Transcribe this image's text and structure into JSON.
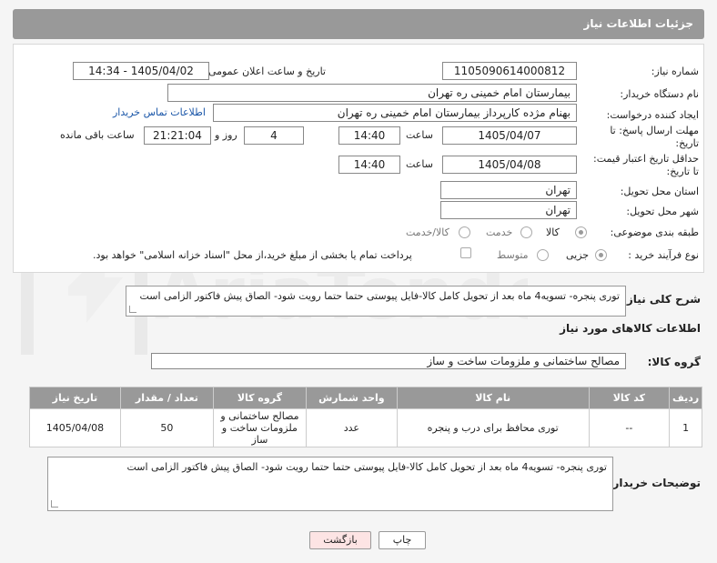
{
  "header": {
    "title": "جزئیات اطلاعات نیاز"
  },
  "form": {
    "need_number_label": "شماره نیاز:",
    "need_number": "1105090614000812",
    "announce_label": "تاریخ و ساعت اعلان عمومی:",
    "announce_value": "1405/04/02 - 14:34",
    "buyer_org_label": "نام دستگاه خریدار:",
    "buyer_org": "بیمارستان امام خمینی ره  تهران",
    "creator_label": "ایجاد کننده درخواست:",
    "creator": "بهنام مژده کارپرداز بیمارستان امام خمینی ره  تهران",
    "contact_link": "اطلاعات تماس خریدار",
    "deadline_label_1": "مهلت ارسال پاسخ: تا",
    "deadline_label_2": "تاریخ:",
    "deadline_date": "1405/04/07",
    "time_word": "ساعت",
    "deadline_time": "14:40",
    "days_value": "4",
    "days_word": "روز و",
    "remaining_time": "21:21:04",
    "remaining_word": "ساعت باقی مانده",
    "price_label_1": "حداقل تاریخ اعتبار قیمت:",
    "price_label_2": "تا تاریخ:",
    "price_date": "1405/04/08",
    "price_time": "14:40",
    "province_label": "استان محل تحویل:",
    "province": "تهران",
    "city_label": "شهر محل تحویل:",
    "city": "تهران",
    "category_label": "طبقه بندی موضوعی:",
    "category_options": [
      "کالا",
      "خدمت",
      "کالا/خدمت"
    ],
    "process_label": "نوع فرآیند خرید :",
    "process_options": [
      "جزیی",
      "متوسط"
    ],
    "payment_note": "پرداخت تمام یا بخشی از مبلغ خرید،از محل \"اسناد خزانه اسلامی\" خواهد بود."
  },
  "description": {
    "label": "شرح کلی نیاز:",
    "text": "توری پنجره-  تسویه4 ماه بعد از تحویل کامل کالا-فایل پیوستی حتما حتما رویت شود- الصاق پیش فاکتور الزامی است"
  },
  "goods_section": {
    "title": "اطلاعات کالاهای مورد نیاز",
    "group_label": "گروه کالا:",
    "group_value": "مصالح ساختمانی و ملزومات ساخت و ساز"
  },
  "table": {
    "headers": [
      "ردیف",
      "کد کالا",
      "نام کالا",
      "واحد شمارش",
      "گروه کالا",
      "تعداد / مقدار",
      "تاریخ نیاز"
    ],
    "rows": [
      [
        "1",
        "--",
        "توری محافظ برای درب و پنجره",
        "عدد",
        "مصالح ساختمانی و ملزومات ساخت و ساز",
        "50",
        "1405/04/08"
      ]
    ]
  },
  "buyer_notes": {
    "label": "توضیحات خریدار:",
    "text": "توری پنجره-  تسویه4 ماه بعد از تحویل کامل کالا-فایل پیوستی حتما حتما رویت شود- الصاق پیش فاکتور الزامی است"
  },
  "buttons": {
    "print": "چاپ",
    "back": "بازگشت"
  },
  "colors": {
    "header_bg": "#999999",
    "link": "#1a56a8",
    "back_bg": "#fde4e4"
  }
}
